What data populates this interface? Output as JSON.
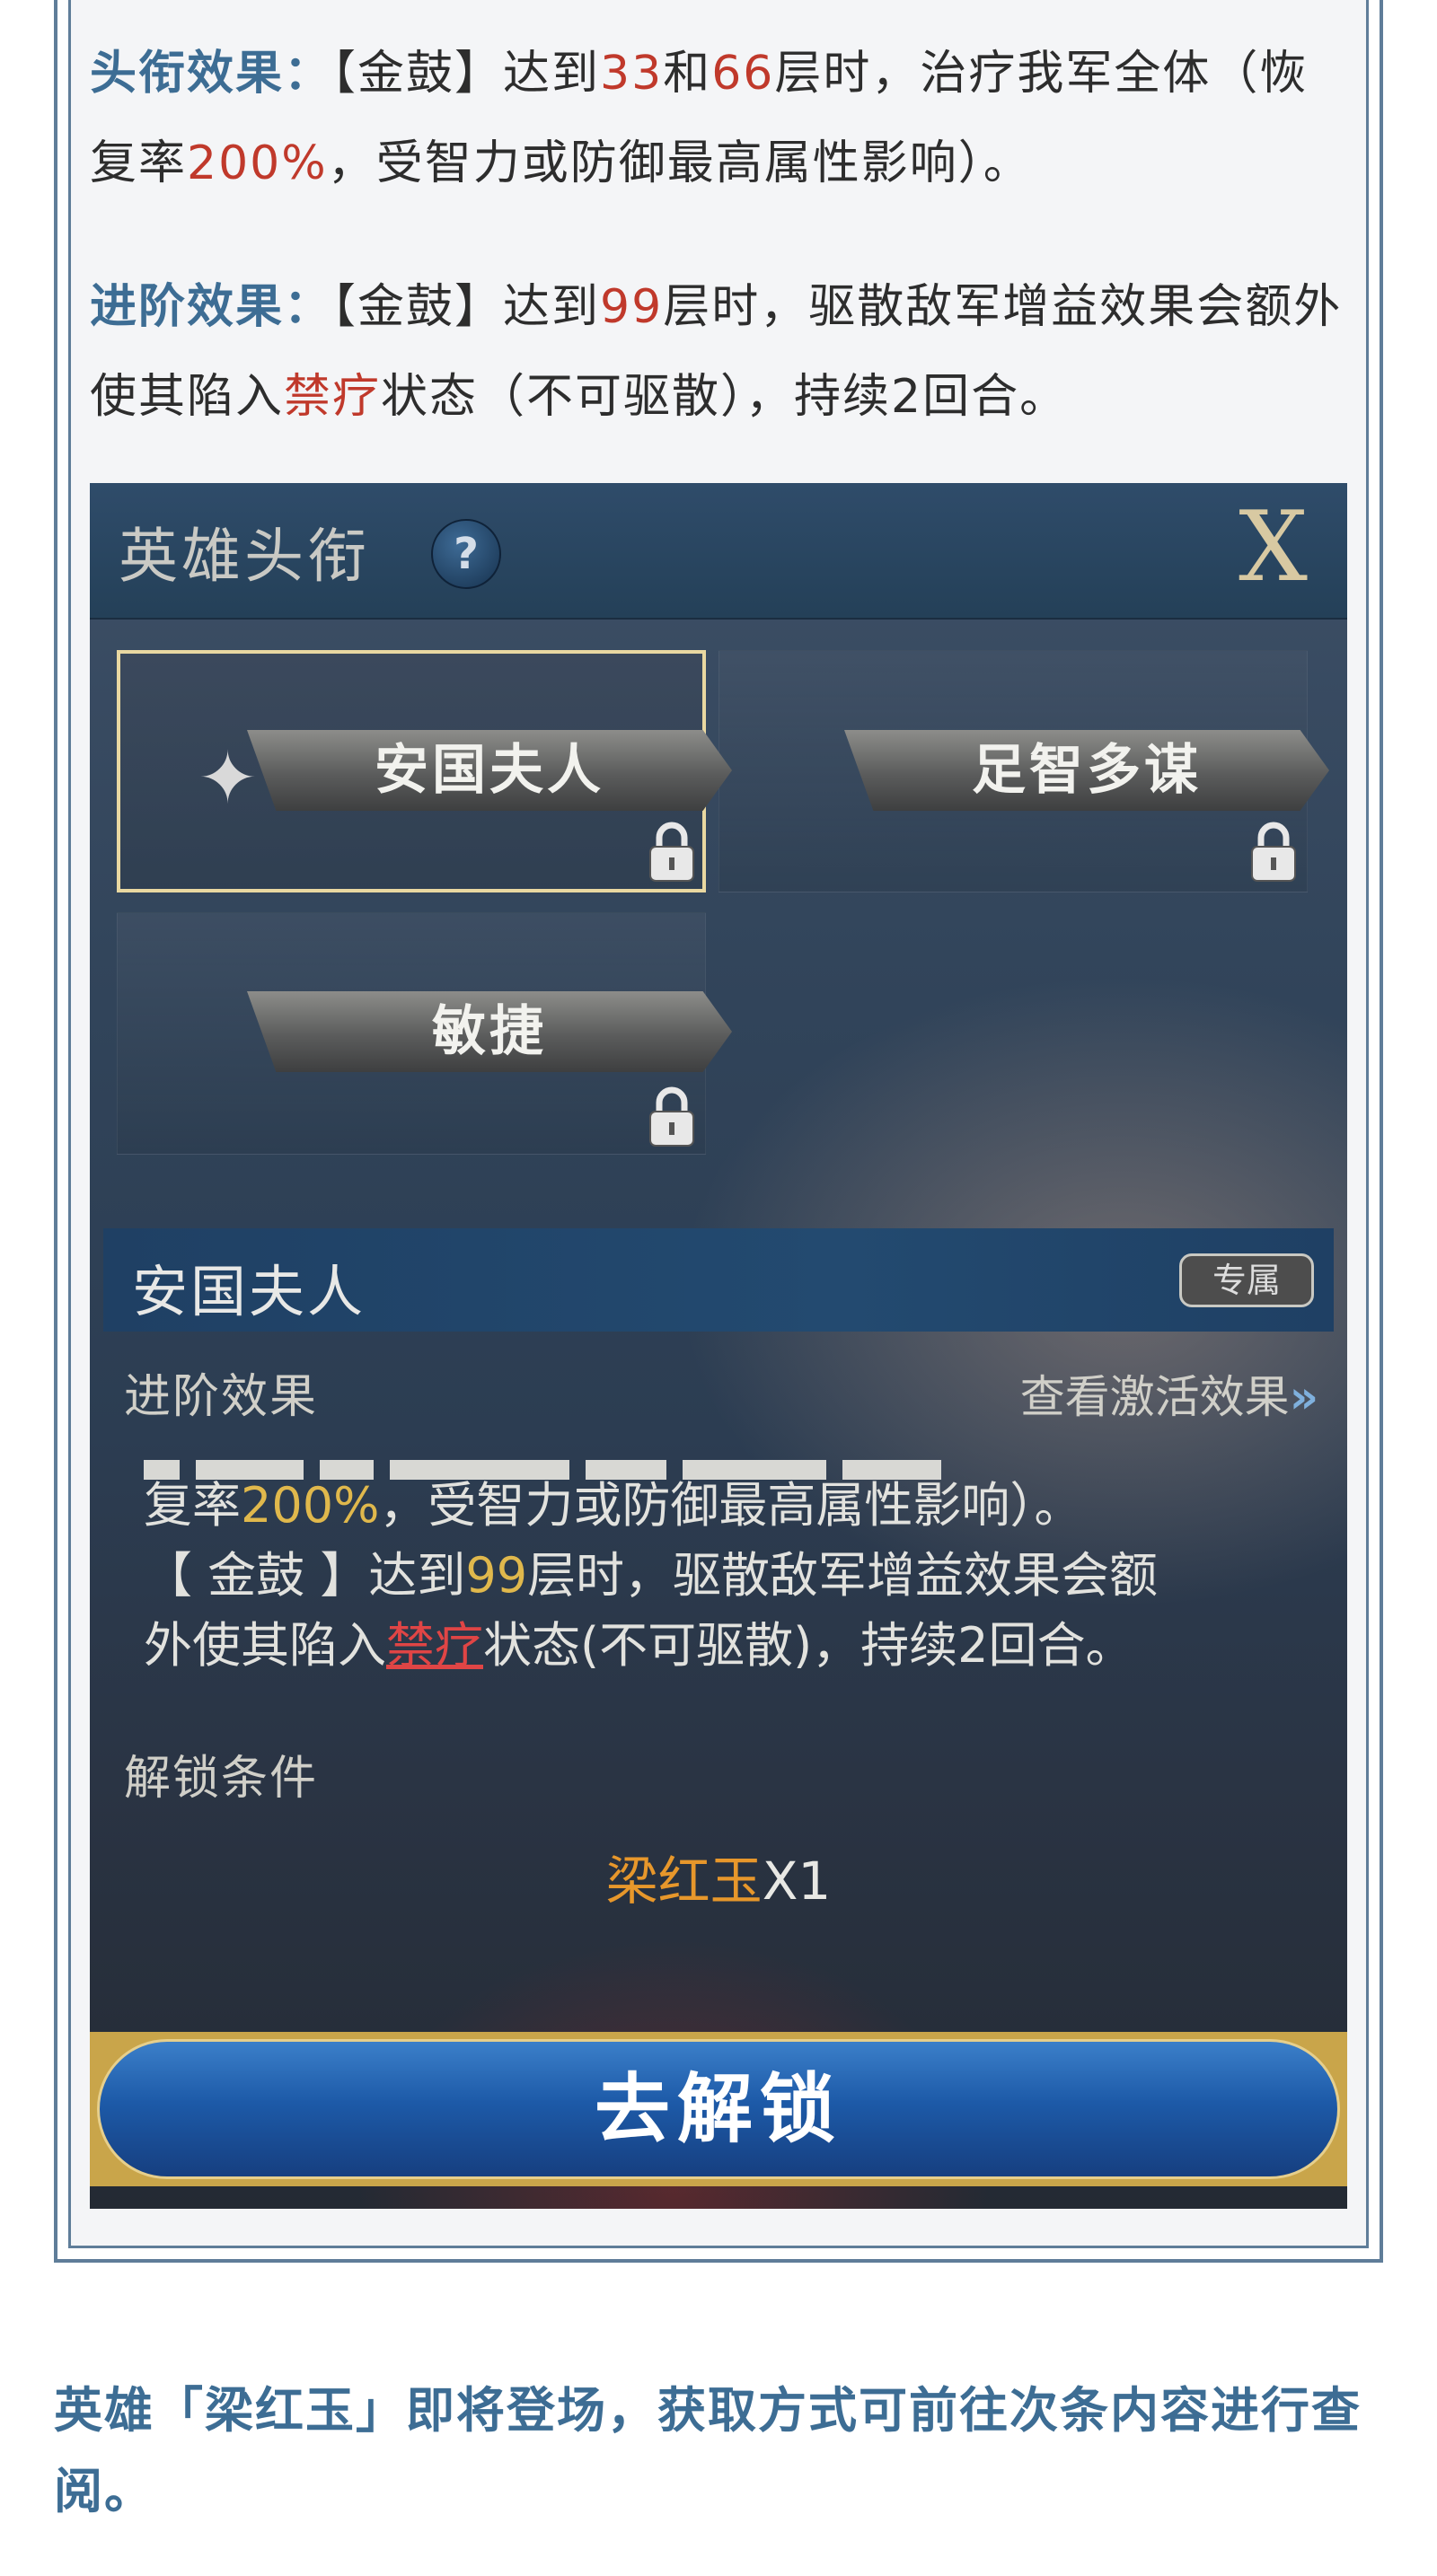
{
  "article": {
    "para1": {
      "label": "头衔效果：",
      "t1": "【金鼓】达到",
      "n1": "33",
      "t2": "和",
      "n2": "66",
      "t3": "层时，治疗我军全体（恢复率",
      "n3": "200%",
      "t4": "，受智力或防御最高属性影响）。"
    },
    "para2": {
      "label": "进阶效果：",
      "t1": "【金鼓】达到",
      "n1": "99",
      "t2": "层时，驱散敌军增益效果会额外使其陷入",
      "n2": "禁疗",
      "t3": "状态（不可驱散），持续2回合。"
    },
    "footer": "英雄「梁红玉」即将登场，获取方式可前往次条内容进行查阅。"
  },
  "game": {
    "header_title": "英雄头衔",
    "help_symbol": "?",
    "close_symbol": "X",
    "titles": [
      "安国夫人",
      "足智多谋",
      "敏捷"
    ],
    "selected_index": 0,
    "band_title": "安国夫人",
    "badge": "专属",
    "section_advanced": "进阶效果",
    "view_link": "查看激活效果",
    "desc": {
      "l1a": "复率",
      "l1b": "200%",
      "l1c": "，受智力或防御最高属性影响）。",
      "l2a": "【 金鼓 】达到",
      "l2b": "99",
      "l2c": "层时，驱散敌军增益效果会额",
      "l3a": "外使其陷入",
      "l3b": "禁疗",
      "l3c": "状态(不可驱散)，持续2回合。"
    },
    "section_unlock": "解锁条件",
    "unlock_item": "梁红玉",
    "unlock_qty": "X1",
    "unlock_button": "去解锁"
  },
  "colors": {
    "label_blue": "#3d6d94",
    "number_red": "#c0392b",
    "gold_text": "#e0b84c",
    "orange_item": "#e7972b",
    "button_blue": "#1d5aa8"
  }
}
